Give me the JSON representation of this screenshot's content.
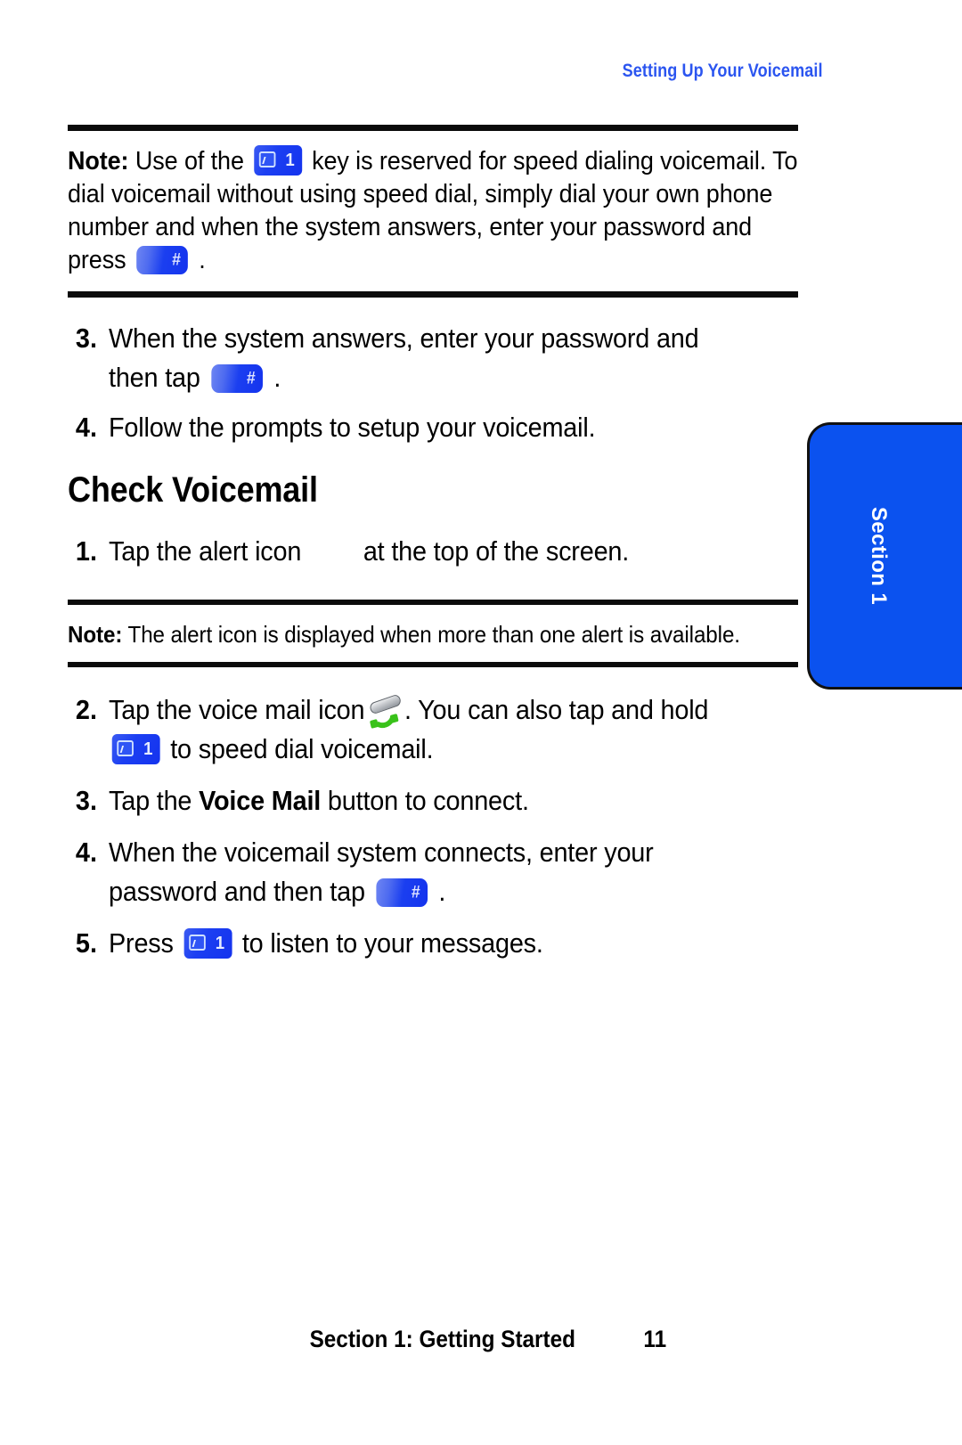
{
  "running_head": "Setting Up Your Voicemail",
  "note_1": {
    "label": "Note:",
    "part_1": "Use of the",
    "part_2": "key is reserved for speed dialing voicemail. To dial voicemail without using speed dial, simply dial your own phone number and when the system answers, enter your password and press",
    "part_3": "."
  },
  "steps_setup": [
    {
      "number": "3.",
      "text_before": "When the system answers, enter your password and then tap",
      "text_after": "."
    },
    {
      "number": "4.",
      "text_before": "Follow the prompts to setup your voicemail.",
      "text_after": ""
    }
  ],
  "heading": "Check Voicemail",
  "steps_check_a": [
    {
      "number": "1.",
      "text_before": "Tap the alert icon",
      "text_after": "at the top of the screen."
    }
  ],
  "note_2": {
    "label": "Note:",
    "text": "The alert icon is displayed when more than one alert is available."
  },
  "steps_check_b": [
    {
      "number": "2.",
      "text_a": "Tap the voice mail icon",
      "text_b": ". You can also tap and hold",
      "text_c": "to speed dial voicemail."
    },
    {
      "number": "3.",
      "text_a": "Tap the ",
      "bold": "Voice Mail",
      "text_b": " button to connect."
    },
    {
      "number": "4.",
      "text_a": "When the voicemail system connects, enter your password and then tap",
      "text_b": "."
    },
    {
      "number": "5.",
      "text_a": "Press",
      "text_b": "to listen to your messages."
    }
  ],
  "side_tab": {
    "label": "Section 1"
  },
  "footer": {
    "title": "Section 1: Getting Started",
    "page": "11"
  },
  "keys": {
    "hash_glyph": "#",
    "one_glyph": "1"
  },
  "colors": {
    "accent_blue": "#2b55f0",
    "tab_blue": "#0b52ef",
    "key_blue": "#1433ee",
    "handset_green": "#39c21a",
    "rule_black": "#0b0b0b"
  }
}
